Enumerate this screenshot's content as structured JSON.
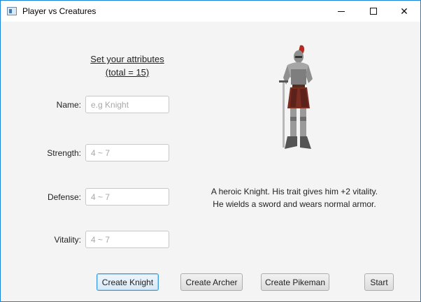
{
  "window": {
    "title": "Player vs Creatures",
    "controls": {
      "minimize_icon": "minimize-icon",
      "maximize_icon": "maximize-icon",
      "close_icon": "close-icon",
      "close_glyph": "✕"
    }
  },
  "form": {
    "heading_line1": "Set your attributes",
    "heading_line2": "(total = 15)",
    "fields": [
      {
        "label": "Name:",
        "value": "",
        "placeholder": "e.g Knight"
      },
      {
        "label": "Strength:",
        "value": "",
        "placeholder": "4 ~ 7"
      },
      {
        "label": "Defense:",
        "value": "",
        "placeholder": "4 ~ 7"
      },
      {
        "label": "Vitality:",
        "value": "",
        "placeholder": "4 ~ 7"
      }
    ]
  },
  "character": {
    "image": "knight-image",
    "description_line1": "A heroic Knight. His trait gives him +2 vitality.",
    "description_line2": "He wields a sword and wears normal armor."
  },
  "buttons": {
    "create_knight": "Create Knight",
    "create_archer": "Create Archer",
    "create_pikeman": "Create Pikeman",
    "start": "Start"
  },
  "colors": {
    "window_border": "#1883d7",
    "focus": "#3c9cd9",
    "background": "#f4f4f4"
  }
}
